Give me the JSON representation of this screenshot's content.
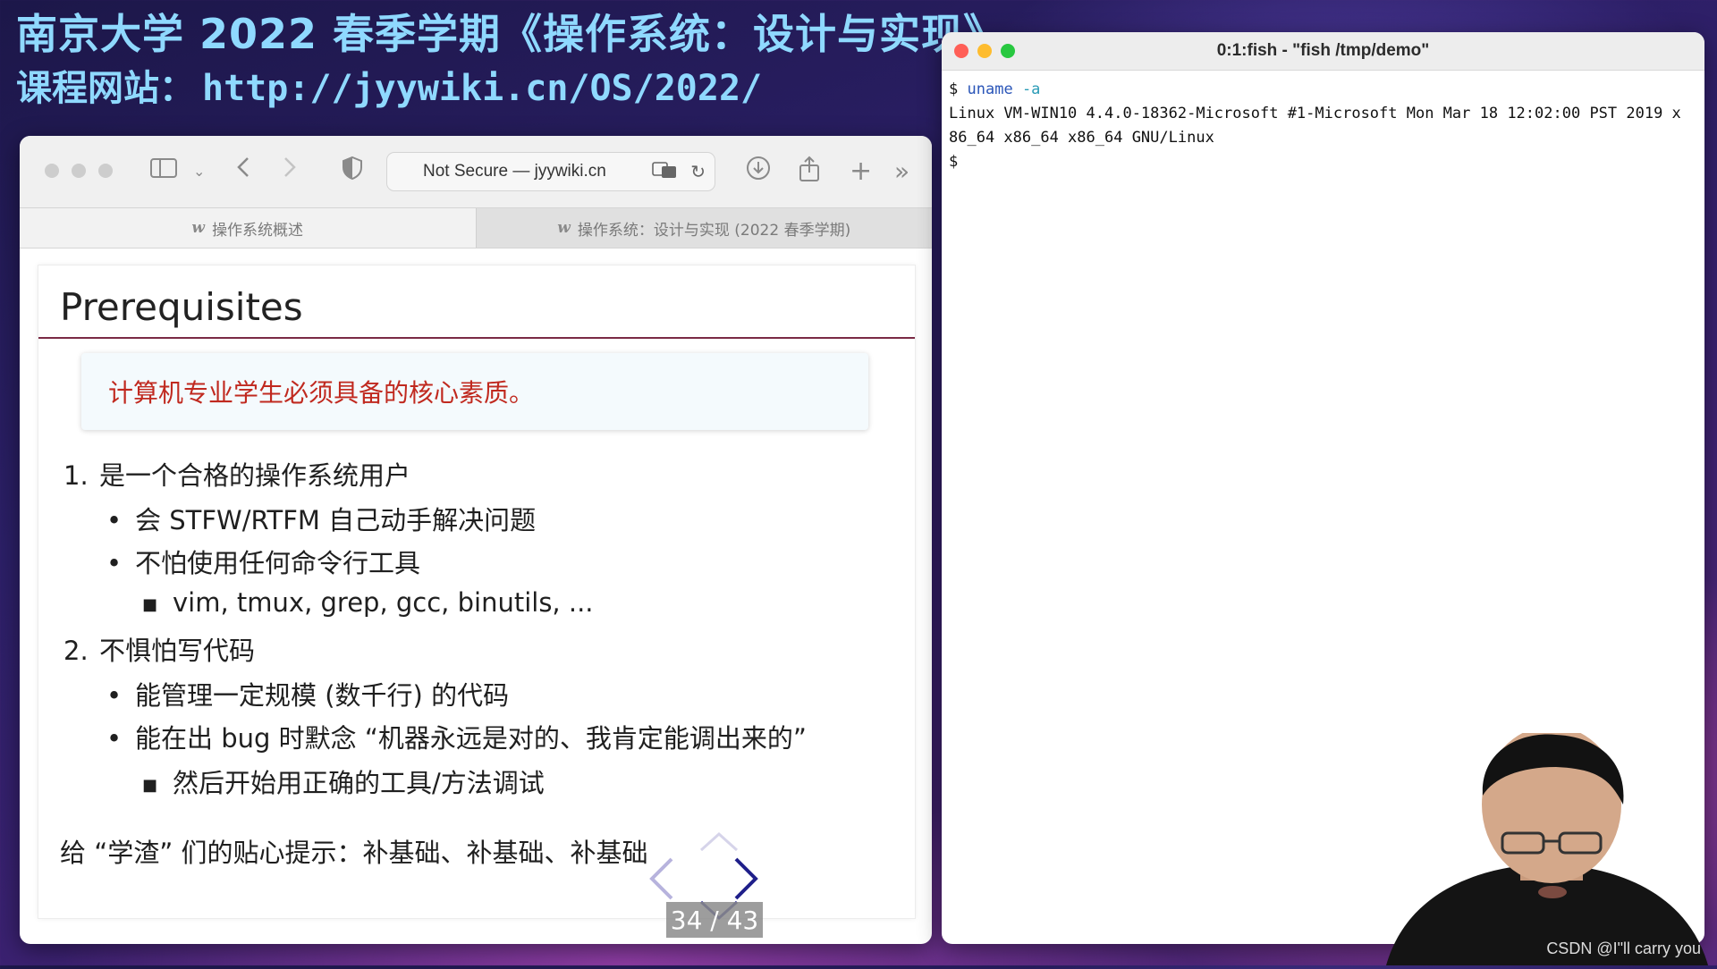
{
  "banner": {
    "title": "南京大学 2022 春季学期《操作系统：设计与实现》",
    "website_label": "课程网站：",
    "website_url": "http://jyywiki.cn/OS/2022/"
  },
  "browser": {
    "address": "Not Secure — jyywiki.cn",
    "tabs": [
      {
        "label": "操作系统概述"
      },
      {
        "label": "操作系统：设计与实现 (2022 春季学期)"
      }
    ]
  },
  "slide": {
    "title": "Prerequisites",
    "callout": "计算机专业学生必须具备的核心素质。",
    "items": [
      {
        "num": "1.",
        "text": "是一个合格的操作系统用户"
      },
      {
        "bullet": "•",
        "text": "会 STFW/RTFM 自己动手解决问题"
      },
      {
        "bullet": "•",
        "text": "不怕使用任何命令行工具"
      },
      {
        "sq": "■",
        "text": "vim, tmux, grep, gcc, binutils, ..."
      },
      {
        "num": "2.",
        "text": "不惧怕写代码"
      },
      {
        "bullet": "•",
        "text": "能管理一定规模 (数千行) 的代码"
      },
      {
        "bullet": "•",
        "text": "能在出 bug 时默念 “机器永远是对的、我肯定能调出来的”"
      },
      {
        "sq": "■",
        "text": "然后开始用正确的工具/方法调试"
      }
    ],
    "footer": "给 “学渣” 们的贴心提示：补基础、补基础、补基础",
    "page_number": "34 / 43"
  },
  "terminal": {
    "title": "0:1:fish - \"fish /tmp/demo\"",
    "prompt": "$",
    "command": "uname",
    "argument": "-a",
    "output_line1": "Linux VM-WIN10 4.4.0-18362-Microsoft #1-Microsoft Mon Mar 18 12:02:00 PST 2019 x",
    "output_line2": "86_64 x86_64 x86_64 GNU/Linux",
    "prompt2": "$"
  },
  "watermark": "CSDN @I\"ll  carry  you",
  "colors": {
    "banner_text": "#8fd9ff",
    "title_rule": "#7a2a45",
    "callout_text": "#c0291f",
    "nav_prev": "#b7b3dd",
    "nav_next": "#1f1f8a"
  }
}
